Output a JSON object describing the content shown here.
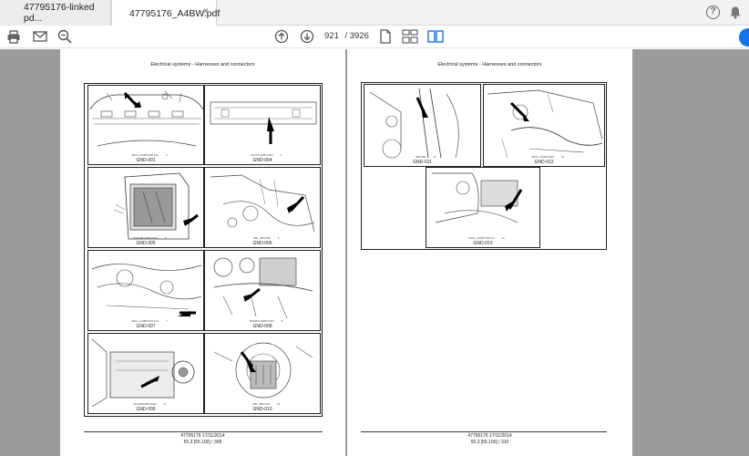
{
  "tabs": [
    {
      "label": "47795176-linked pd..."
    },
    {
      "label": "47795176_A4BW.pdf",
      "close": "×"
    }
  ],
  "header_icons": {
    "help": "help-circle-icon",
    "notifications": "bell-icon",
    "help_glyph": "?"
  },
  "toolbar": {
    "current_page": "921",
    "total_pages": "/ 3926",
    "icons": [
      "print-icon",
      "email-icon",
      "zoom-out-icon",
      "page-up-icon",
      "page-down-icon",
      "single-page-view-icon",
      "two-page-scroll-icon",
      "two-page-view-icon"
    ]
  },
  "pages": [
    {
      "header": "Electrical systems - Harnesses and connectors",
      "footer_line1": "47795176 17/11/2014",
      "footer_line2": "55.3 [55.100] / 309",
      "figures": [
        {
          "code": "00GC_11ABTC020 ALA",
          "num": "3",
          "caption": "GND-001"
        },
        {
          "code": "ACFTC71ABTC020",
          "num": "4",
          "caption": "GND-004"
        },
        {
          "code": "NGVG4B1ABTC026A",
          "num": "5",
          "caption": "GND-005"
        },
        {
          "code": "UBF_ABTC020",
          "num": "6",
          "caption": "GND-006"
        },
        {
          "code": "00GC_11ABTC020 ALA",
          "num": "7",
          "caption": "GND-007"
        },
        {
          "code": "BCGMT110ABTC020",
          "num": "8",
          "caption": "GND-008"
        },
        {
          "code": "NGVGB1ABTC026A",
          "num": "9",
          "caption": "GND-009"
        },
        {
          "code": "UBF_ABTC020",
          "num": "10",
          "caption": "GND-010"
        }
      ]
    },
    {
      "header": "Electrical systems - Harnesses and connectors",
      "footer_line1": "47795176 17/11/2014",
      "footer_line2": "55.3 [55.100] / 310",
      "figures": [
        {
          "code": "BSIT1B1",
          "num": "11",
          "caption": "GND-011"
        },
        {
          "code": "ADUC_11ABTC020",
          "num": "12",
          "caption": "GND-012"
        },
        {
          "code": "00GC_11ABTC020 AL",
          "num": "13",
          "caption": "GND-013"
        }
      ]
    }
  ],
  "colors": {
    "accent": "#1473e6",
    "viewer_bg": "#9b9b9b",
    "tab_bar": "#f2f2f2"
  }
}
